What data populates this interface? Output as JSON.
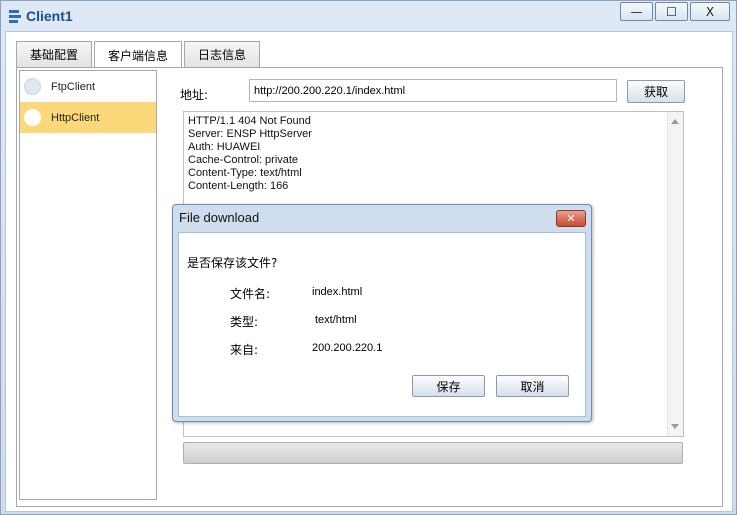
{
  "window": {
    "title": "Client1",
    "minimize_glyph": "—",
    "maximize_glyph": "☐",
    "close_glyph": "X"
  },
  "tabs": [
    {
      "label": "基础配置"
    },
    {
      "label": "客户端信息"
    },
    {
      "label": "日志信息"
    }
  ],
  "active_tab": "客户端信息",
  "sidebar": {
    "items": [
      {
        "label": "FtpClient"
      },
      {
        "label": "HttpClient"
      }
    ],
    "selected": "HttpClient"
  },
  "address": {
    "label": "地址:",
    "value": "http://200.200.220.1/index.html"
  },
  "fetch_button": "获取",
  "response": {
    "lines": [
      "HTTP/1.1 404 Not Found",
      "Server: ENSP HttpServer",
      "Auth: HUAWEI",
      "Cache-Control: private",
      "Content-Type: text/html",
      "Content-Length: 166"
    ]
  },
  "progress": {
    "percent": 0
  },
  "dialog": {
    "title": "File download",
    "close_glyph": "✕",
    "question": "是否保存该文件?",
    "rows": [
      {
        "label": "文件名:",
        "value": "index.html"
      },
      {
        "label": "类型:",
        "value": "text/html"
      },
      {
        "label": "来自:",
        "value": "200.200.220.1"
      }
    ],
    "save_button": "保存",
    "cancel_button": "取消"
  },
  "colors": {
    "title_text": "#1a4f8e",
    "selected_item": "#fbd87a",
    "dialog_close": "#c94a30"
  }
}
